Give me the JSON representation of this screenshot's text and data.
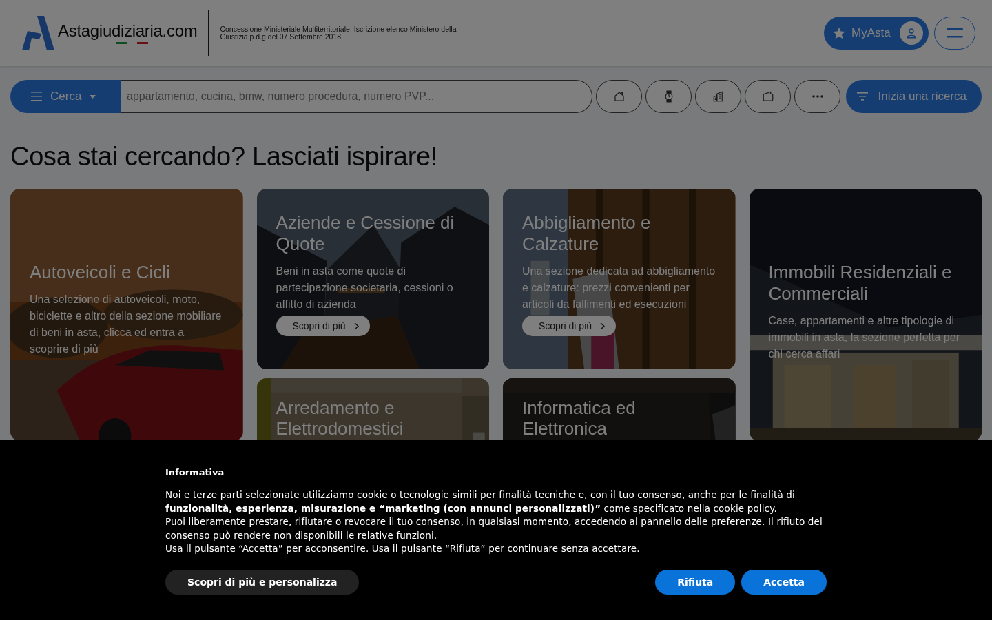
{
  "header": {
    "logo": "Astagiudiziaria.com",
    "tagline": "Concessione Ministeriale Multiterritoriale. Iscrizione elenco Ministero della Giustizia p.d.g del 07 Settembre 2018",
    "myasta_button": "MyAsta"
  },
  "search": {
    "menu_button": "Cerca",
    "placeholder": "appartamento, cucina, bmw, numero procedura, numero PVP...",
    "search_button": "Inizia una ricerca"
  },
  "heading": "Cosa stai cercando? Lasciati ispirare!",
  "categories": [
    {
      "title": "Autoveicoli e Cicli",
      "description": "Una selezione di autoveicoli, moto, biciclette e altro della sezione mobiliare di beni in asta, clicca ed entra a scoprire di più"
    },
    {
      "title": "Aziende e Cessione di Quote",
      "description": "Beni in asta come quote di partecipazione societaria, cessioni o affitto di azienda",
      "button": "Scopri di più"
    },
    {
      "title": "Abbigliamento e Calzature",
      "description": "Una sezione dedicata ad abbigliamento e calzature: prezzi convenienti per articoli da fallimenti ed esecuzioni",
      "button": "Scopri di più"
    },
    {
      "title": "Immobili Residenziali e Commerciali",
      "description": "Case, appartamenti e altre tipologie di immobili in asta, la sezione perfetta per chi cerca affari"
    },
    {
      "title": "Arredamento e Elettrodomestici"
    },
    {
      "title": "Informatica ed Elettronica"
    }
  ],
  "cookie_banner": {
    "title": "Informativa",
    "paragraphs": [
      {
        "text": "Noi e terze parti selezionate utilizziamo cookie o tecnologie simili per finalità tecniche e, con il tuo consenso, anche per le finalità di **funzionalità, esperienza, misurazione e “marketing (con annunci personalizzati)”** come specificato nella ",
        "link": "cookie policy",
        "text_after": "."
      },
      {
        "text": "Puoi liberamente prestare, rifiutare o revocare il tuo consenso, in qualsiasi momento, accedendo al pannello delle preferenze. Il rifiuto del consenso può rendere non disponibili le relative funzioni."
      },
      {
        "text": "Usa il pulsante “Accetta” per acconsentire. Usa il pulsante “Rifiuta” per continuare senza accettare."
      }
    ],
    "customize_button": "Scopri di più e personalizza",
    "reject_button": "Rifiuta",
    "accept_button": "Accetta"
  }
}
